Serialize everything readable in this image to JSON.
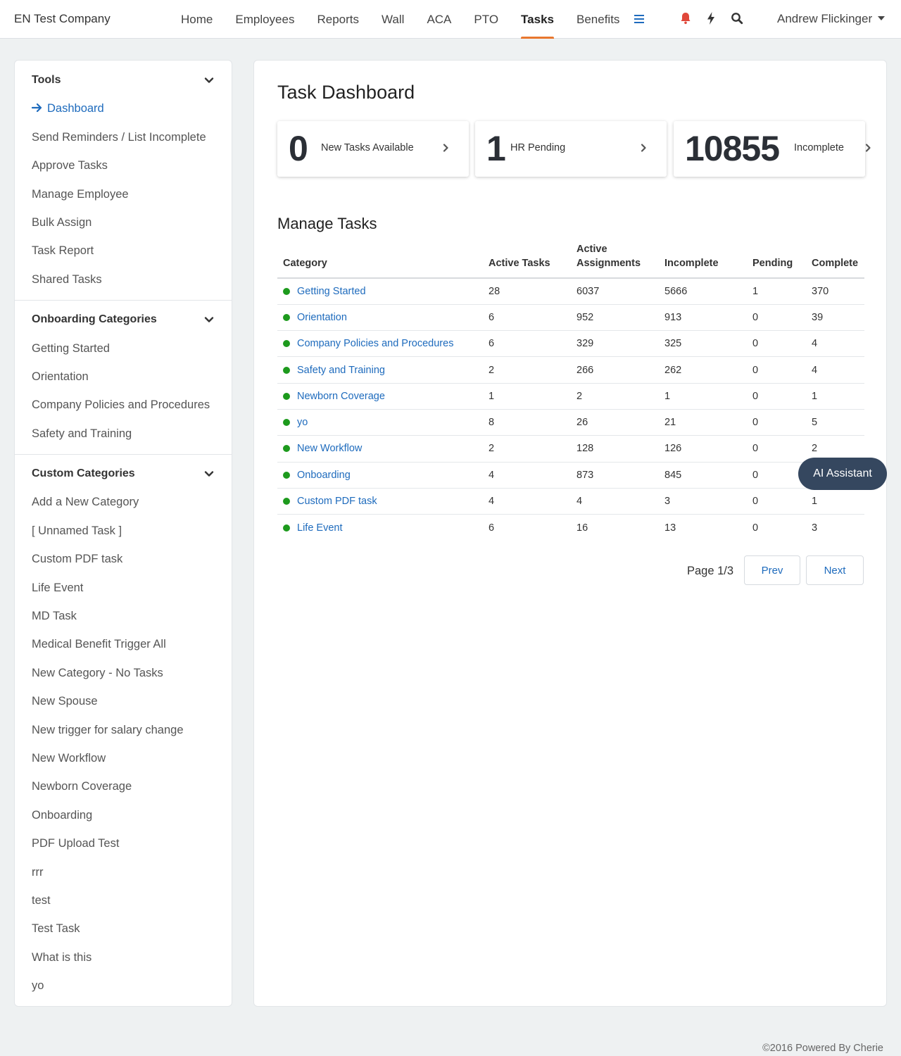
{
  "brand": "EN Test Company",
  "nav": {
    "items": [
      "Home",
      "Employees",
      "Reports",
      "Wall",
      "ACA",
      "PTO",
      "Tasks",
      "Benefits"
    ],
    "active": "Tasks",
    "user": "Andrew Flickinger"
  },
  "sidebar": {
    "tools": {
      "title": "Tools",
      "items": [
        "Dashboard",
        "Send Reminders / List Incomplete",
        "Approve Tasks",
        "Manage Employee",
        "Bulk Assign",
        "Task Report",
        "Shared Tasks"
      ],
      "active": "Dashboard"
    },
    "onboarding": {
      "title": "Onboarding Categories",
      "items": [
        "Getting Started",
        "Orientation",
        "Company Policies and Procedures",
        "Safety and Training"
      ]
    },
    "custom": {
      "title": "Custom Categories",
      "items": [
        "Add a New Category",
        "[ Unnamed Task ]",
        "Custom PDF task",
        "Life Event",
        "MD Task",
        "Medical Benefit Trigger All",
        "New Category - No Tasks",
        "New Spouse",
        "New trigger for salary change",
        "New Workflow",
        "Newborn Coverage",
        "Onboarding",
        "PDF Upload Test",
        "rrr",
        "test",
        "Test Task",
        "What is this",
        "yo"
      ]
    }
  },
  "main": {
    "title": "Task Dashboard",
    "stats": [
      {
        "value": "0",
        "label": "New Tasks Available"
      },
      {
        "value": "1",
        "label": "HR Pending"
      },
      {
        "value": "10855",
        "label": "Incomplete"
      }
    ],
    "manage_title": "Manage Tasks",
    "table": {
      "headers": [
        "Category",
        "Active Tasks",
        "Active Assignments",
        "Incomplete",
        "Pending",
        "Complete"
      ],
      "rows": [
        [
          "Getting Started",
          "28",
          "6037",
          "5666",
          "1",
          "370"
        ],
        [
          "Orientation",
          "6",
          "952",
          "913",
          "0",
          "39"
        ],
        [
          "Company Policies and Procedures",
          "6",
          "329",
          "325",
          "0",
          "4"
        ],
        [
          "Safety and Training",
          "2",
          "266",
          "262",
          "0",
          "4"
        ],
        [
          "Newborn Coverage",
          "1",
          "2",
          "1",
          "0",
          "1"
        ],
        [
          "yo",
          "8",
          "26",
          "21",
          "0",
          "5"
        ],
        [
          "New Workflow",
          "2",
          "128",
          "126",
          "0",
          "2"
        ],
        [
          "Onboarding",
          "4",
          "873",
          "845",
          "0",
          ""
        ],
        [
          "Custom PDF task",
          "4",
          "4",
          "3",
          "0",
          "1"
        ],
        [
          "Life Event",
          "6",
          "16",
          "13",
          "0",
          "3"
        ]
      ]
    },
    "pager": {
      "text": "Page 1/3",
      "prev": "Prev",
      "next": "Next"
    }
  },
  "ai_assistant": "AI Assistant",
  "footer": "©2016 Powered By Cherie",
  "colors": {
    "accent": "#1e6bbd",
    "tab_underline": "#e8772e",
    "bell": "#e0473a",
    "status_dot": "#1d9a1d",
    "ai_button": "#35475f"
  }
}
